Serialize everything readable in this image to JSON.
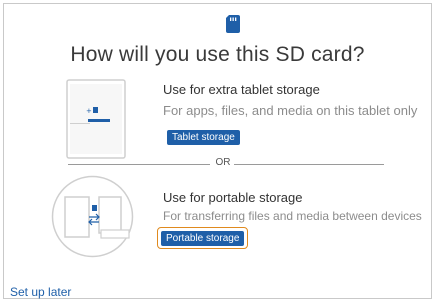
{
  "header": {
    "title": "How will you use this SD card?",
    "icon": "sd-card-icon",
    "icon_color": "#1f5fa8"
  },
  "options": [
    {
      "title": "Use for extra tablet storage",
      "description": "For apps, files, and media on this tablet only",
      "button_label": "Tablet storage",
      "illustration": "tablet-storage-illustration"
    },
    {
      "title": "Use for portable storage",
      "description": "For transferring files and media between devices",
      "button_label": "Portable storage",
      "illustration": "portable-storage-illustration",
      "highlighted": true
    }
  ],
  "divider": {
    "label": "OR"
  },
  "footer": {
    "link_label": "Set up later"
  },
  "colors": {
    "accent": "#1f5fa8",
    "highlight": "#e08a1e",
    "border": "#c9c9c9"
  }
}
